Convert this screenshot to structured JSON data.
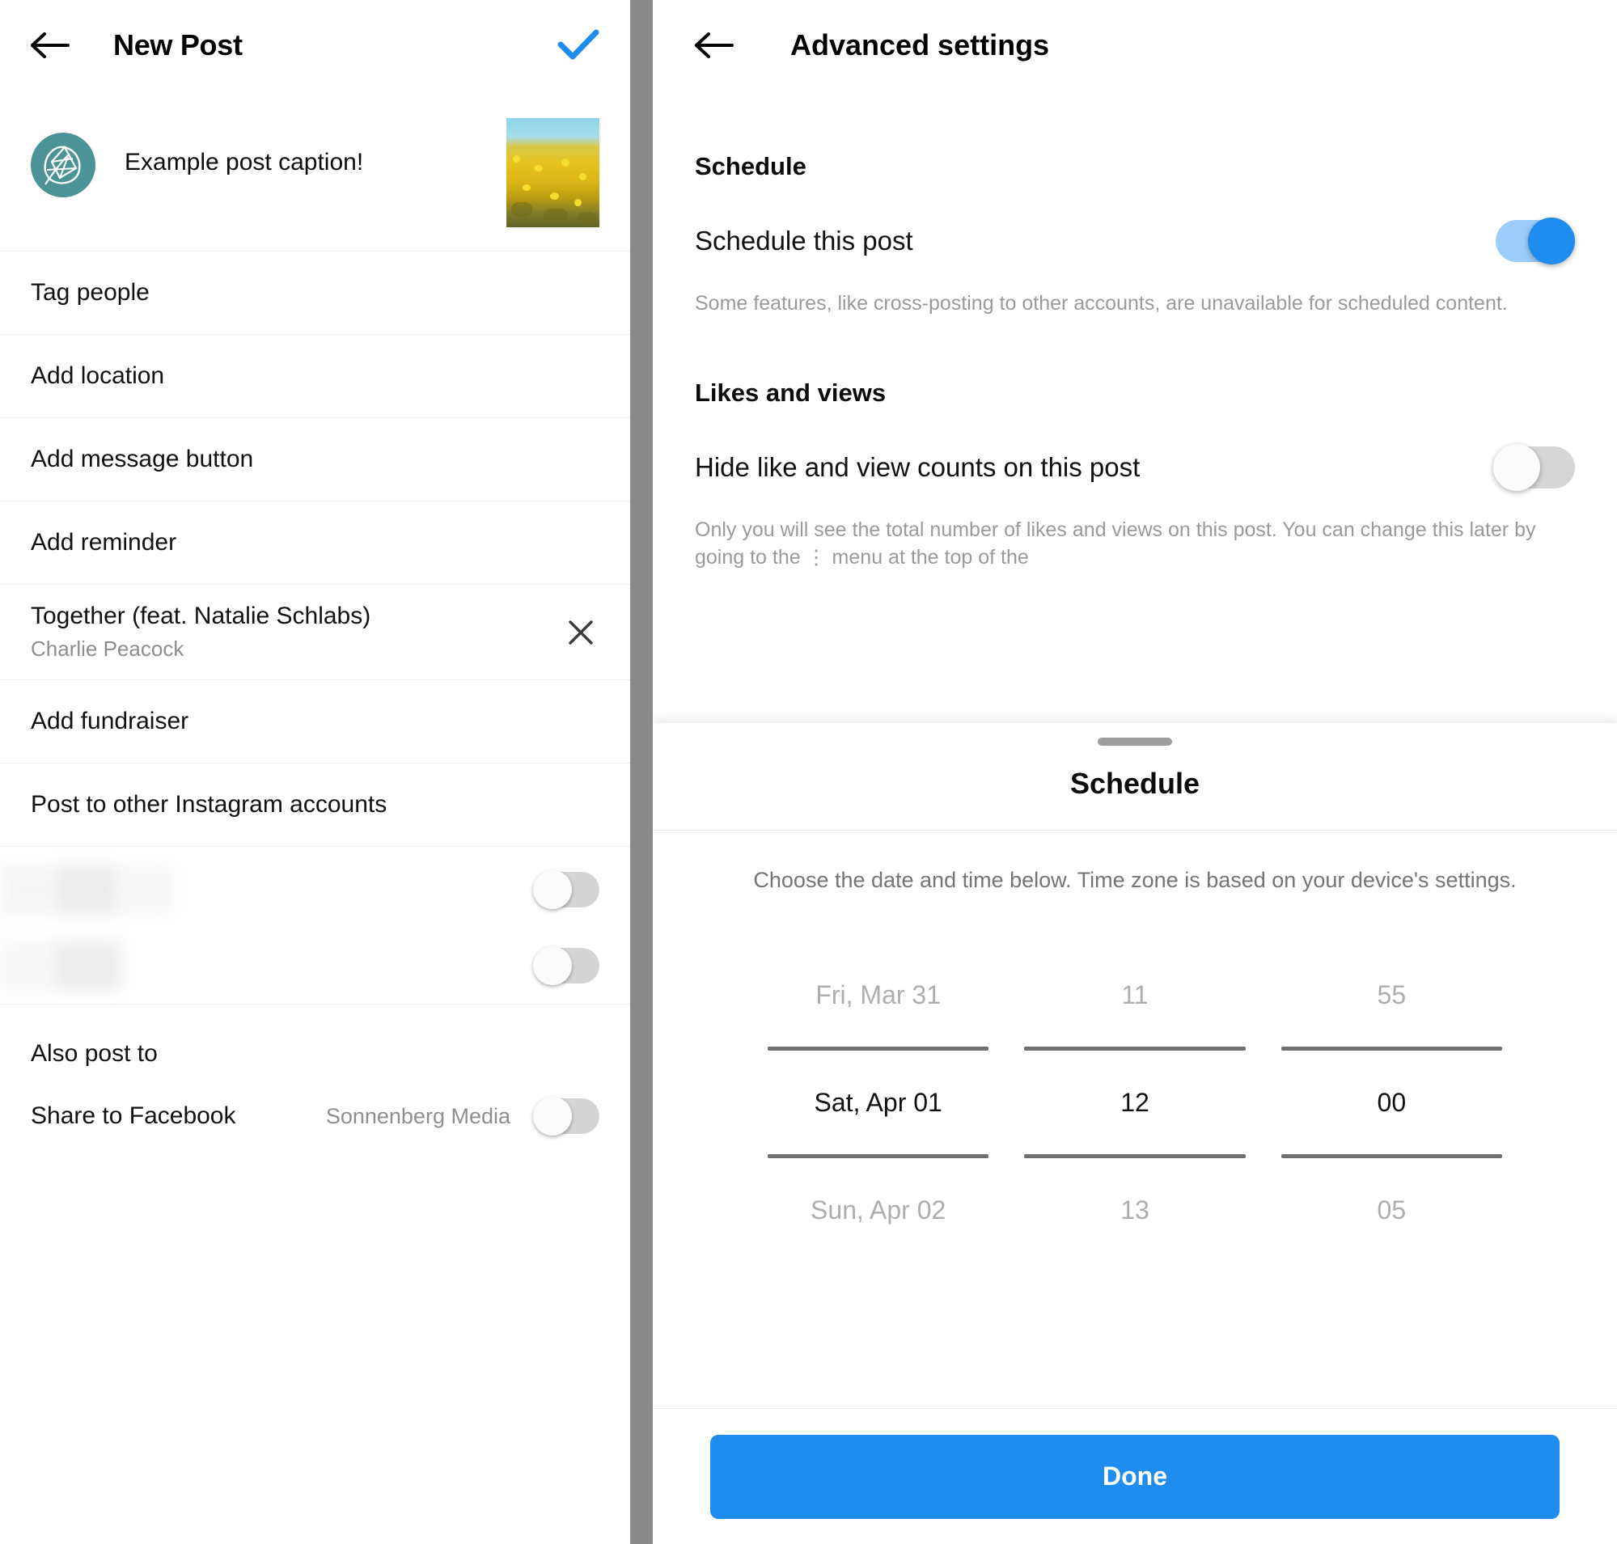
{
  "left_panel": {
    "header": {
      "back_icon": "back-arrow-icon",
      "title": "New Post",
      "confirm_icon": "checkmark-icon",
      "confirm_color": "#1f8cf0"
    },
    "post_preview": {
      "avatar_icon": "leaf-logo-avatar",
      "avatar_color": "#4b9396",
      "caption": "Example post caption!",
      "thumbnail_alt": "yellow-flower-field-thumbnail"
    },
    "options": [
      {
        "label": "Tag people"
      },
      {
        "label": "Add location"
      },
      {
        "label": "Add message button"
      },
      {
        "label": "Add reminder"
      }
    ],
    "music": {
      "title": "Together (feat. Natalie Schlabs)",
      "artist": "Charlie Peacock",
      "remove_icon": "close-icon"
    },
    "fundraiser": {
      "label": "Add fundraiser"
    },
    "cross_post": {
      "label": "Post to other Instagram accounts",
      "accounts": [
        {
          "name_redacted": true,
          "toggle": "off"
        },
        {
          "name_redacted": true,
          "toggle": "off"
        }
      ]
    },
    "also_post_to": {
      "label": "Also post to",
      "facebook": {
        "label": "Share to Facebook",
        "page": "Sonnenberg Media",
        "toggle": "off"
      }
    }
  },
  "right_panel": {
    "header": {
      "back_icon": "back-arrow-icon",
      "title": "Advanced settings"
    },
    "schedule_section": {
      "heading": "Schedule",
      "toggle_label": "Schedule this post",
      "toggle_state": "on",
      "help_text": "Some features, like cross-posting to other accounts, are unavailable for scheduled content."
    },
    "likes_section": {
      "heading": "Likes and views",
      "toggle_label": "Hide like and view counts on this post",
      "toggle_state": "off",
      "help_text": "Only you will see the total number of likes and views on this post. You can change this later by going to the ⋮ menu at the top of the"
    },
    "schedule_sheet": {
      "title": "Schedule",
      "description": "Choose the date and time below. Time zone is based on your device's settings.",
      "picker": {
        "date": {
          "above": "Fri, Mar 31",
          "selected": "Sat, Apr 01",
          "below": "Sun, Apr 02"
        },
        "hour": {
          "above": "11",
          "selected": "12",
          "below": "13"
        },
        "minute": {
          "above": "55",
          "selected": "00",
          "below": "05"
        }
      },
      "done_label": "Done",
      "done_color": "#1f8cf0"
    }
  }
}
